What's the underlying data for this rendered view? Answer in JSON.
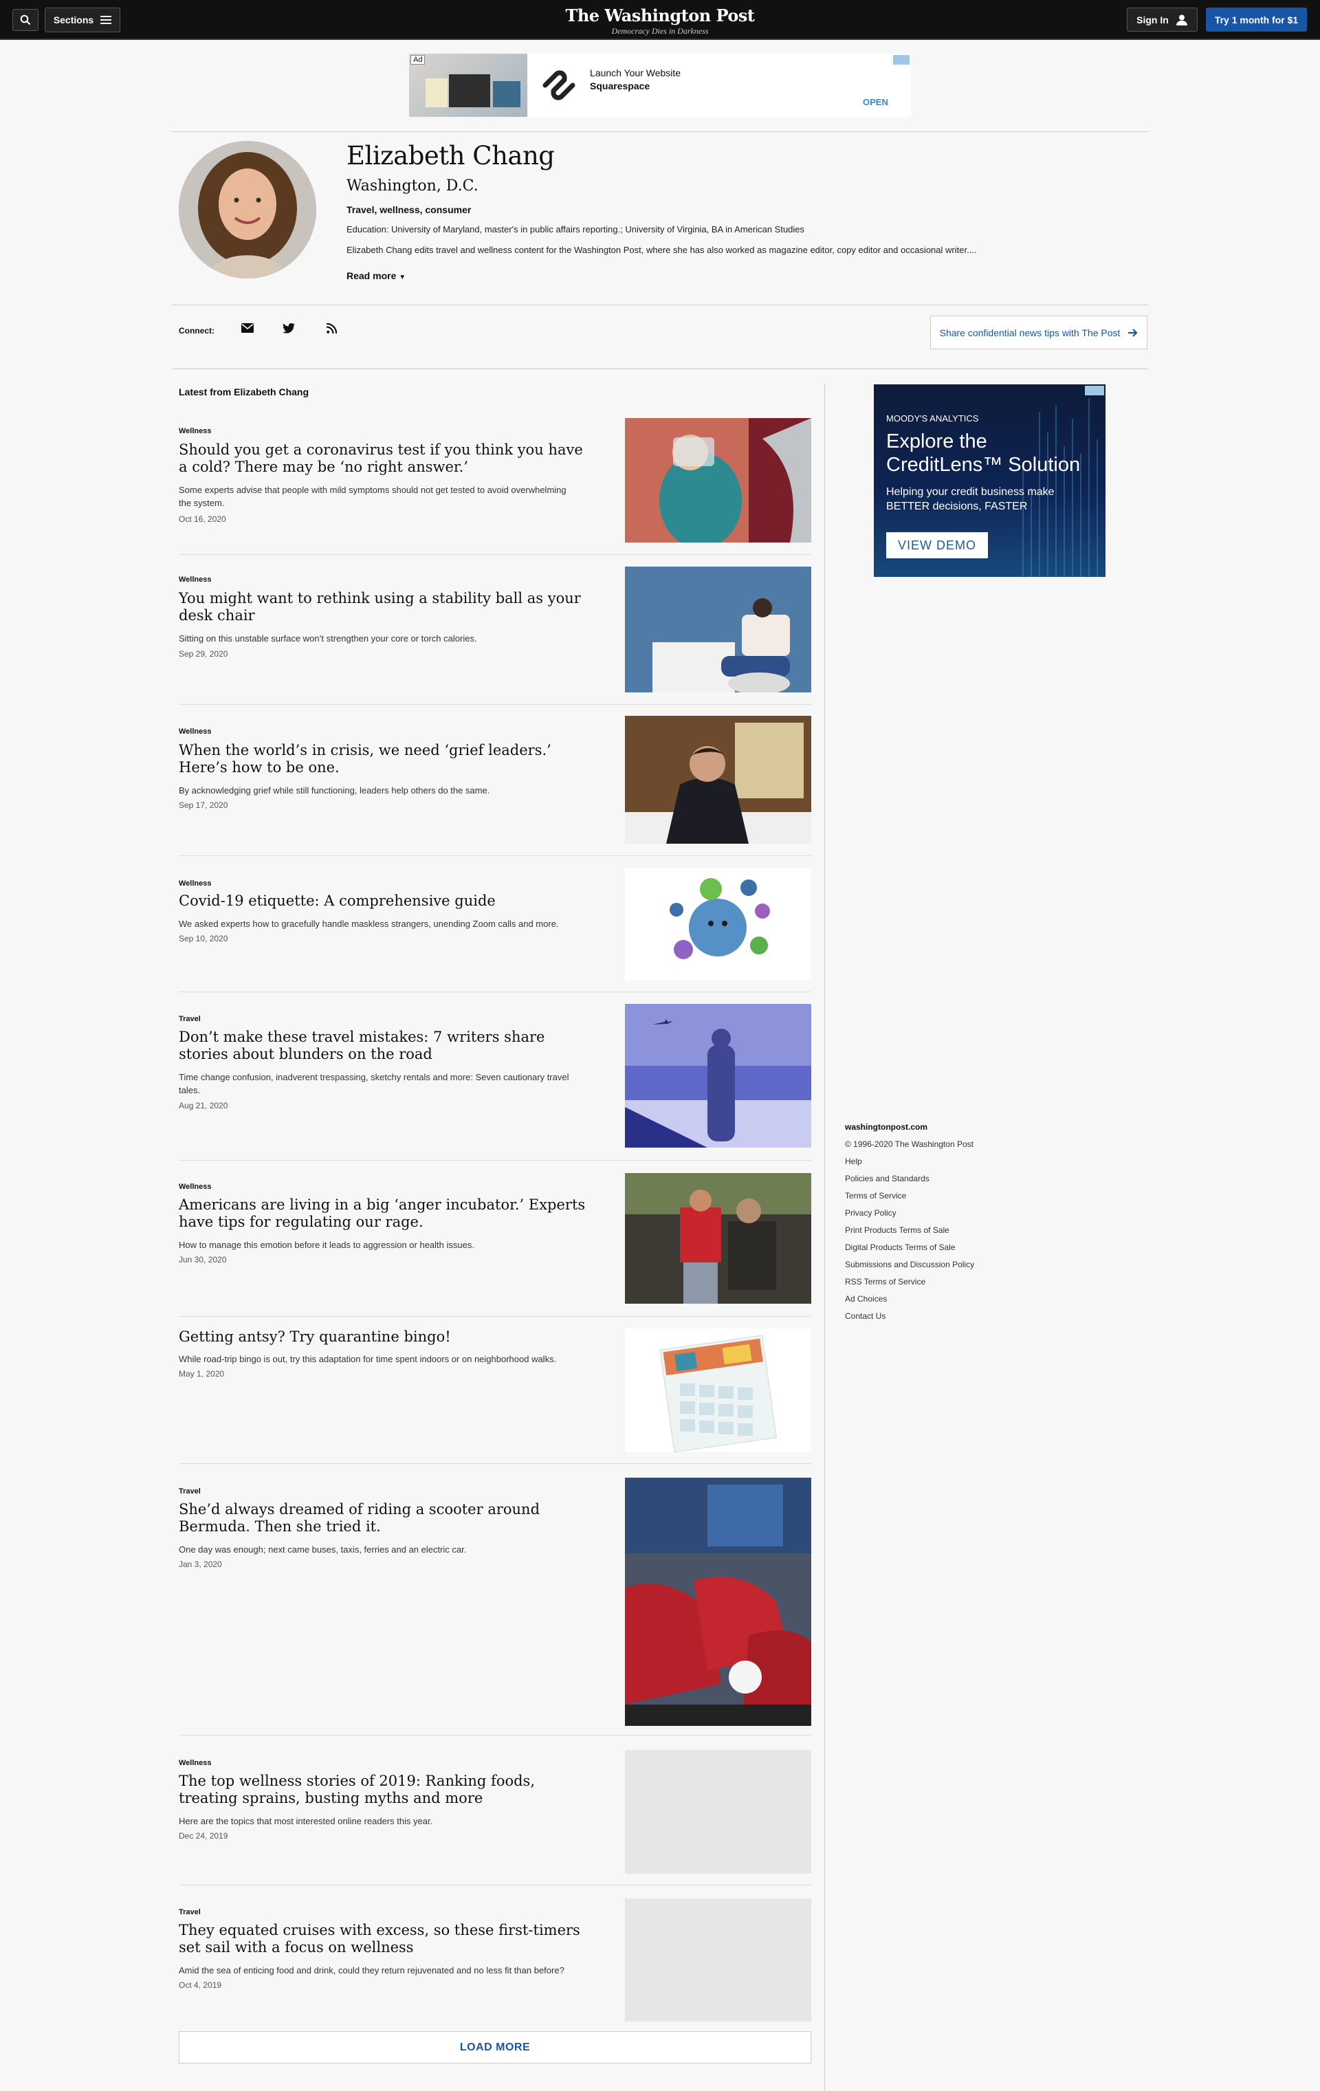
{
  "header": {
    "sections_label": "Sections",
    "logo": "The Washington Post",
    "tagline": "Democracy Dies in Darkness",
    "signin_label": "Sign In",
    "subscribe_label": "Try 1 month for $1"
  },
  "top_ad": {
    "badge": "Ad",
    "line1": "Launch Your Website",
    "line2": "Squarespace",
    "cta": "OPEN"
  },
  "author": {
    "name": "Elizabeth Chang",
    "location": "Washington, D.C.",
    "beat": "Travel, wellness, consumer",
    "education": "Education: University of Maryland, master's in public affairs reporting.; University of Virginia, BA in American Studies",
    "bio": "Elizabeth Chang edits travel and wellness content for the Washington Post, where she has also worked as magazine editor, copy editor and occasional writer....",
    "read_more": "Read more"
  },
  "connect": {
    "label": "Connect:",
    "share_tips": "Share confidential news tips with The Post"
  },
  "latest_label": "Latest from Elizabeth Chang",
  "stories": [
    {
      "kicker": "Wellness",
      "headline": "Should you get a coronavirus test if you think you have a cold? There may be ‘no right answer.’",
      "blurb": "Some experts advise that people with mild symptoms should not get tested to avoid overwhelming the system.",
      "date": "Oct 16, 2020"
    },
    {
      "kicker": "Wellness",
      "headline": "You might want to rethink using a stability ball as your desk chair",
      "blurb": "Sitting on this unstable surface won’t strengthen your core or torch calories.",
      "date": "Sep 29, 2020"
    },
    {
      "kicker": "Wellness",
      "headline": "When the world’s in crisis, we need ‘grief leaders.’ Here’s how to be one.",
      "blurb": "By acknowledging grief while still functioning, leaders help others do the same.",
      "date": "Sep 17, 2020"
    },
    {
      "kicker": "Wellness",
      "headline": "Covid-19 etiquette: A comprehensive guide",
      "blurb": "We asked experts how to gracefully handle maskless strangers, unending Zoom calls and more.",
      "date": "Sep 10, 2020"
    },
    {
      "kicker": "Travel",
      "headline": "Don’t make these travel mistakes: 7 writers share stories about blunders on the road",
      "blurb": "Time change confusion, inadverent trespassing, sketchy rentals and more: Seven cautionary travel tales.",
      "date": "Aug 21, 2020"
    },
    {
      "kicker": "Wellness",
      "headline": "Americans are living in a big ‘anger incubator.’ Experts have tips for regulating our rage.",
      "blurb": "How to manage this emotion before it leads to aggression or health issues.",
      "date": "Jun 30, 2020"
    },
    {
      "kicker": "",
      "headline": "Getting antsy? Try quarantine bingo!",
      "blurb": "While road-trip bingo is out, try this adaptation for time spent indoors or on neighborhood walks.",
      "date": "May 1, 2020"
    },
    {
      "kicker": "Travel",
      "headline": "She’d always dreamed of riding a scooter around Bermuda. Then she tried it.",
      "blurb": "One day was enough; next came buses, taxis, ferries and an electric car.",
      "date": "Jan 3, 2020"
    },
    {
      "kicker": "Wellness",
      "headline": "The top wellness stories of 2019: Ranking foods, treating sprains, busting myths and more",
      "blurb": "Here are the topics that most interested online readers this year.",
      "date": "Dec 24, 2019"
    },
    {
      "kicker": "Travel",
      "headline": "They equated cruises with excess, so these first-timers set sail with a focus on wellness",
      "blurb": "Amid the sea of enticing food and drink, could they return rejuvenated and no less fit than before?",
      "date": "Oct 4, 2019"
    }
  ],
  "load_more": "LOAD MORE",
  "side_ad": {
    "brand": "MOODY'S ANALYTICS",
    "headline_1": "Explore the",
    "headline_2": "CreditLens™ Solution",
    "sub_1": "Helping your credit business make",
    "sub_2": "BETTER decisions, FASTER",
    "cta": "VIEW DEMO"
  },
  "footer": {
    "site": "washingtonpost.com",
    "copyright": "© 1996-2020 The Washington Post",
    "links": [
      "Help",
      "Policies and Standards",
      "Terms of Service",
      "Privacy Policy",
      "Print Products Terms of Sale",
      "Digital Products Terms of Sale",
      "Submissions and Discussion Policy",
      "RSS Terms of Service",
      "Ad Choices",
      "Contact Us"
    ]
  }
}
